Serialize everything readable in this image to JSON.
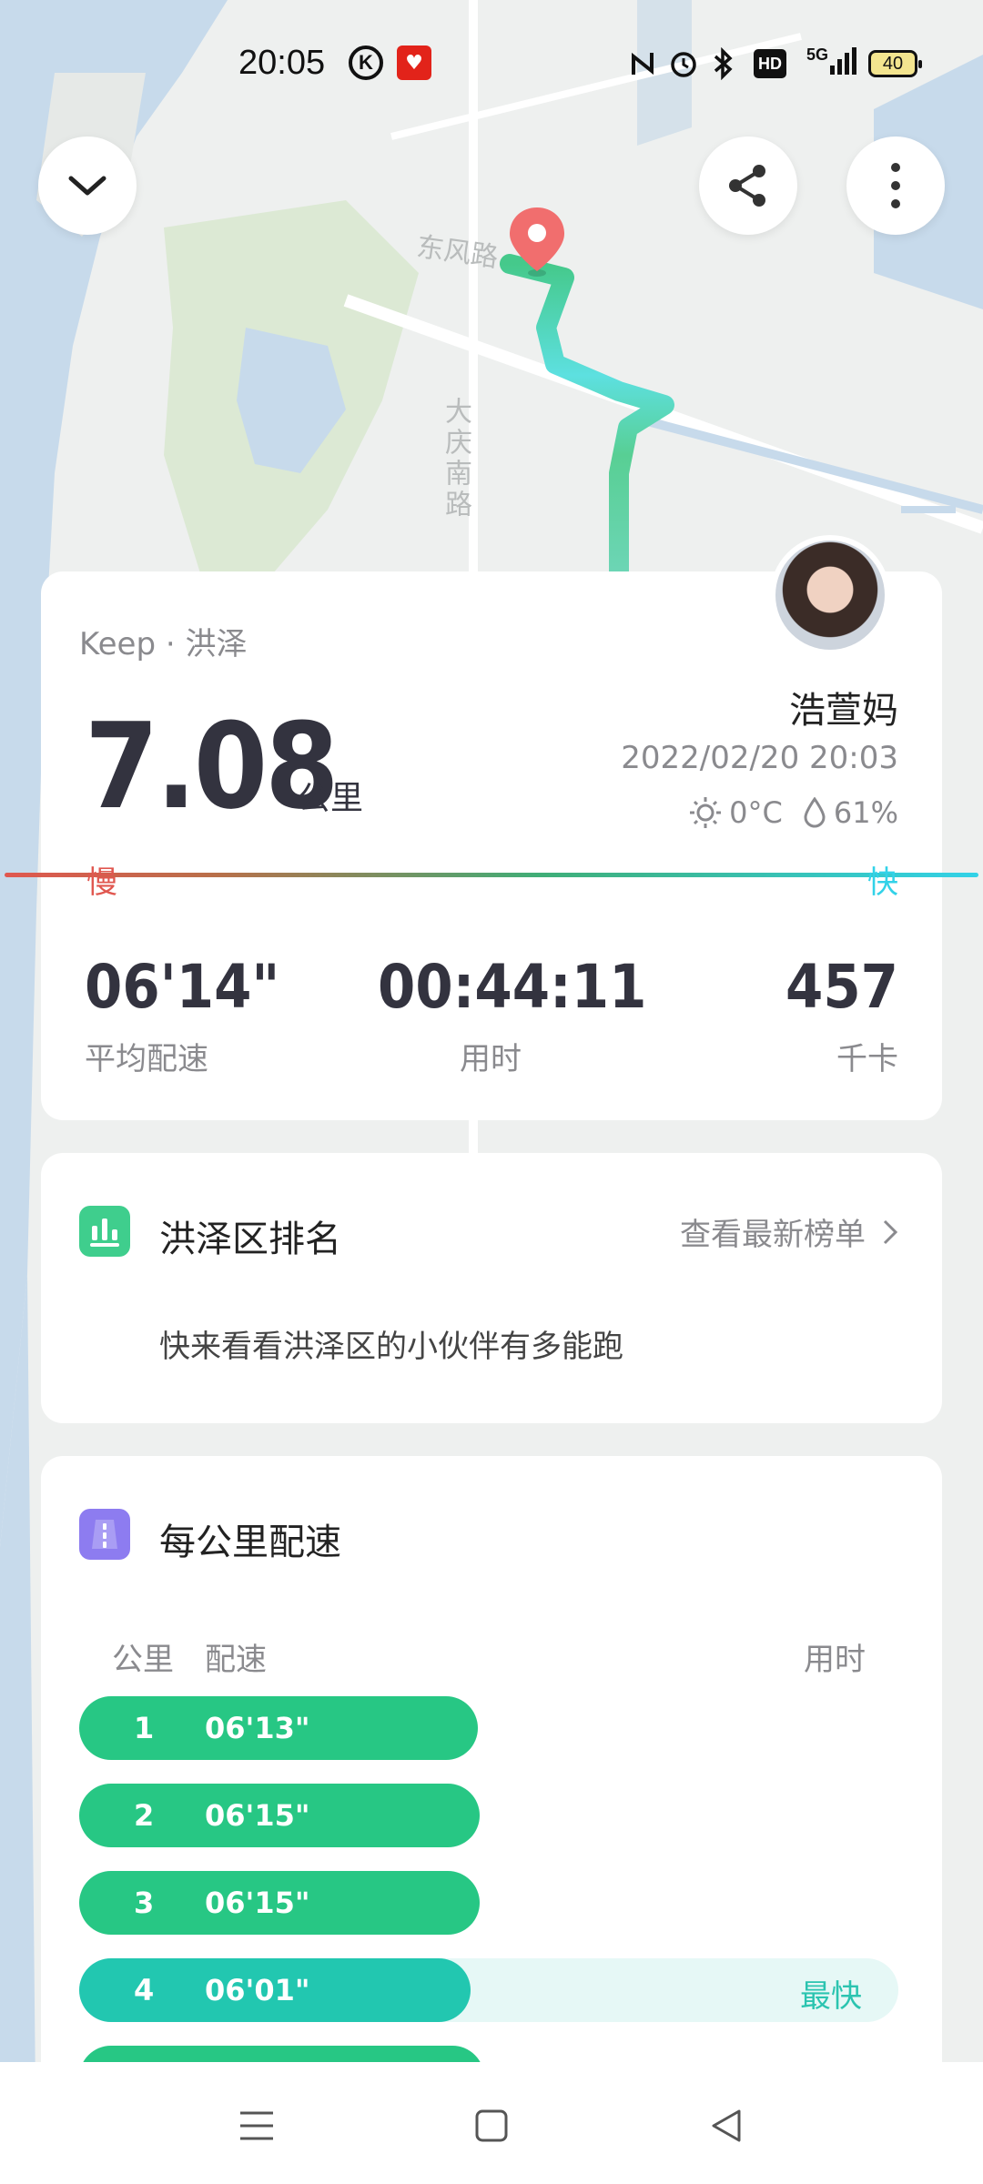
{
  "status_bar": {
    "time": "20:05",
    "left_icons": [
      "k-app-icon",
      "heart-app-icon"
    ],
    "right_icons": [
      "nfc-icon",
      "alarm-icon",
      "bluetooth-icon",
      "hd-icon",
      "signal-5g-icon"
    ],
    "hd_label": "HD",
    "network_label": "5G",
    "battery": "40"
  },
  "map": {
    "labels": [
      "东风路",
      "大庆南路"
    ],
    "colors": {
      "water": "#c7daeb",
      "green": "#dce9d4",
      "route_start": "#45c98b",
      "route_end": "#32d2e8",
      "pin": "#f16e6e"
    }
  },
  "toolbar": {
    "collapse_icon": "chevron-down-icon",
    "share_icon": "share-icon",
    "more_icon": "more-vertical-icon"
  },
  "summary": {
    "source": "Keep · 洪泽",
    "distance": "7.08",
    "distance_unit": "公里",
    "username": "浩萱妈",
    "datetime": "2022/02/20 20:03",
    "temperature": "0°C",
    "humidity": "61%",
    "slow_label": "慢",
    "fast_label": "快",
    "stats": [
      {
        "value": "06'14\"",
        "label": "平均配速"
      },
      {
        "value": "00:44:11",
        "label": "用时"
      },
      {
        "value": "457",
        "label": "千卡"
      }
    ]
  },
  "ranking": {
    "title": "洪泽区排名",
    "link": "查看最新榜单",
    "description": "快来看看洪泽区的小伙伴有多能跑"
  },
  "pace_per_km": {
    "title": "每公里配速",
    "col_km": "公里",
    "col_pace": "配速",
    "col_time": "用时",
    "fastest_label": "最快",
    "rows": [
      {
        "km": "1",
        "pace": "06'13\"",
        "fastest": false
      },
      {
        "km": "2",
        "pace": "06'15\"",
        "fastest": false
      },
      {
        "km": "3",
        "pace": "06'15\"",
        "fastest": false
      },
      {
        "km": "4",
        "pace": "06'01\"",
        "fastest": true
      }
    ]
  },
  "nav": {
    "icons": [
      "menu-icon",
      "home-square-icon",
      "back-triangle-icon"
    ]
  }
}
